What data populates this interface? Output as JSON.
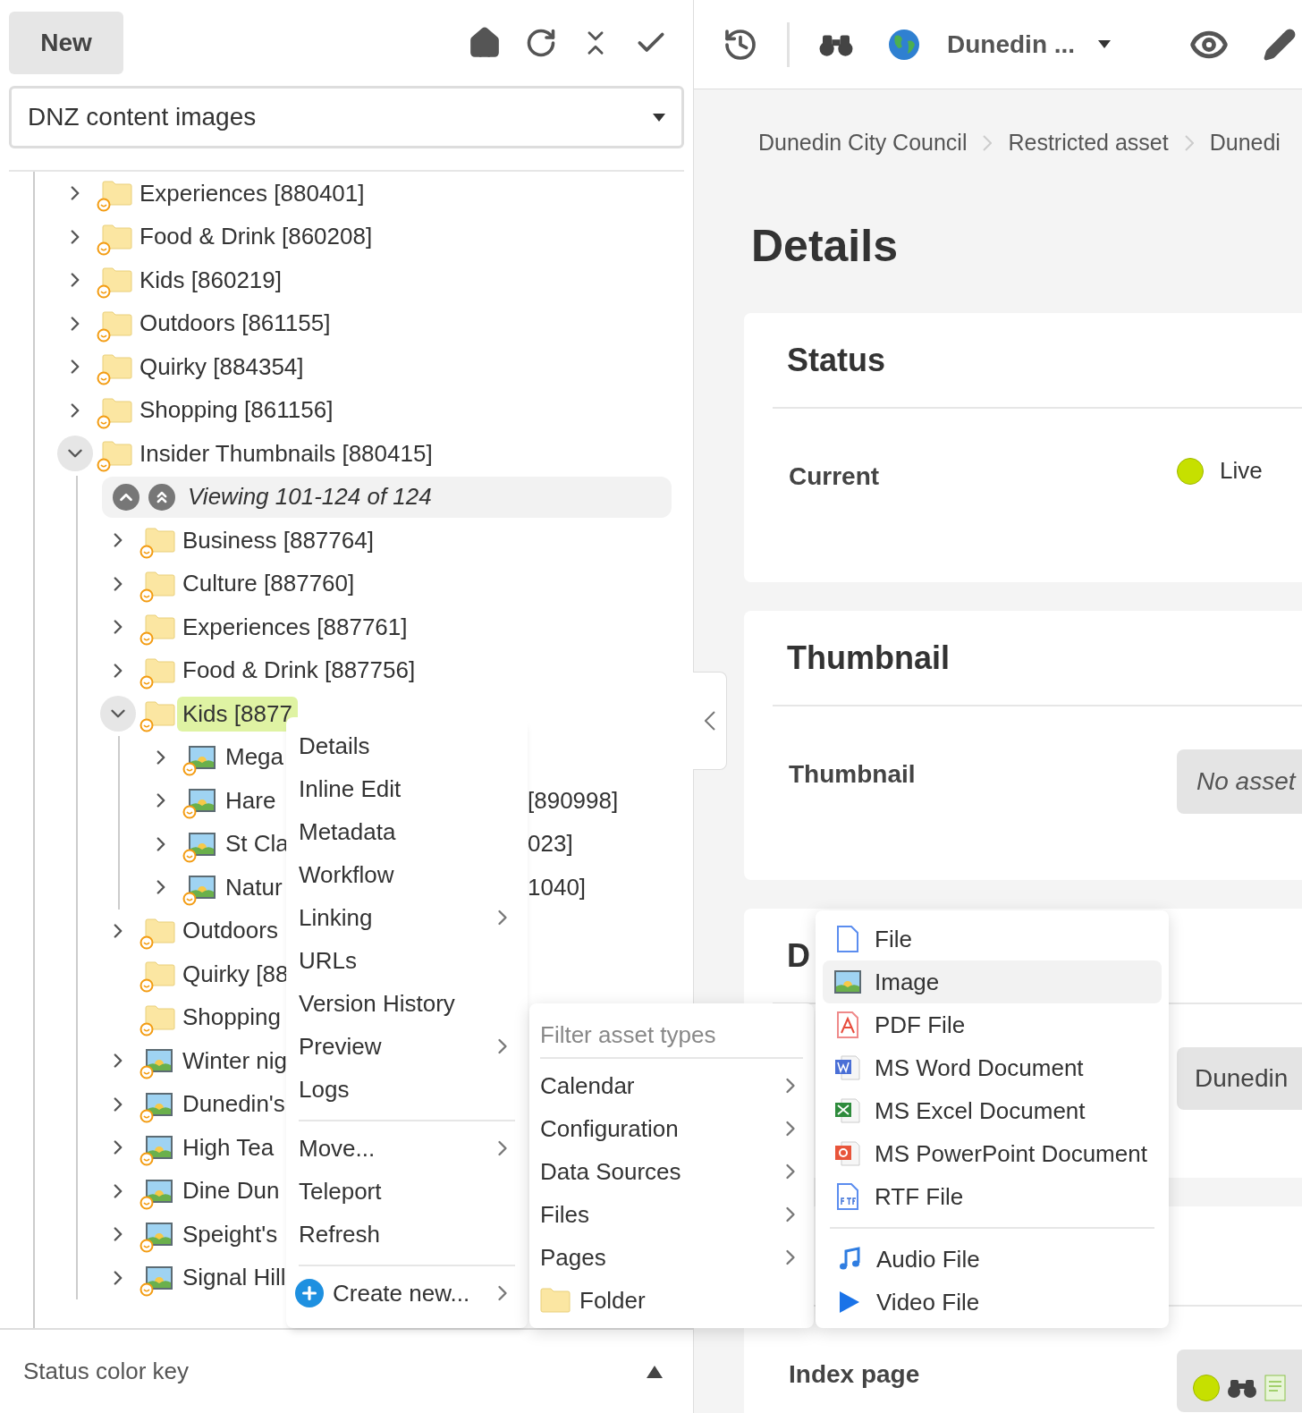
{
  "left_toolbar": {
    "new_button": "New"
  },
  "asset_selector": {
    "value": "DNZ content images"
  },
  "tree": [
    {
      "label": "Experiences [880401]",
      "kind": "folder",
      "expandable": true,
      "expanded": false,
      "selected": false
    },
    {
      "label": "Food & Drink [860208]",
      "kind": "folder",
      "expandable": true,
      "expanded": false,
      "selected": false
    },
    {
      "label": "Kids [860219]",
      "kind": "folder",
      "expandable": true,
      "expanded": false,
      "selected": false
    },
    {
      "label": "Outdoors [861155]",
      "kind": "folder",
      "expandable": true,
      "expanded": false,
      "selected": false
    },
    {
      "label": "Quirky [884354]",
      "kind": "folder",
      "expandable": true,
      "expanded": false,
      "selected": false
    },
    {
      "label": "Shopping [861156]",
      "kind": "folder",
      "expandable": true,
      "expanded": false,
      "selected": false
    },
    {
      "label": "Insider Thumbnails [880415]",
      "kind": "folder",
      "expandable": true,
      "expanded": true,
      "selected": false,
      "children": [
        {
          "label": "Viewing 101-124 of 124",
          "kind": "pager"
        },
        {
          "label": "Business [887764]",
          "kind": "folder",
          "expandable": true,
          "expanded": false,
          "selected": false
        },
        {
          "label": "Culture [887760]",
          "kind": "folder",
          "expandable": true,
          "expanded": false,
          "selected": false
        },
        {
          "label": "Experiences [887761]",
          "kind": "folder",
          "expandable": true,
          "expanded": false,
          "selected": false
        },
        {
          "label": "Food & Drink [887756]",
          "kind": "folder",
          "expandable": true,
          "expanded": false,
          "selected": false
        },
        {
          "label": "Kids [8877",
          "kind": "folder",
          "expandable": true,
          "expanded": true,
          "selected": true,
          "children": [
            {
              "label": "Mega",
              "kind": "image",
              "expandable": true,
              "expanded": false,
              "selected": false
            },
            {
              "label": "Hare",
              "tail": "[890998]",
              "kind": "image",
              "expandable": true,
              "expanded": false,
              "selected": false
            },
            {
              "label": "St Cla",
              "tail": "023]",
              "kind": "image",
              "expandable": true,
              "expanded": false,
              "selected": false
            },
            {
              "label": "Natur",
              "tail": "1040]",
              "kind": "image",
              "expandable": true,
              "expanded": false,
              "selected": false
            }
          ]
        },
        {
          "label": "Outdoors",
          "kind": "folder",
          "expandable": true,
          "expanded": false,
          "selected": false
        },
        {
          "label": "Quirky [88",
          "kind": "folder",
          "expandable": false,
          "expanded": false,
          "selected": false
        },
        {
          "label": "Shopping",
          "kind": "folder",
          "expandable": false,
          "expanded": false,
          "selected": false
        },
        {
          "label": "Winter nig",
          "kind": "image",
          "expandable": true,
          "expanded": false,
          "selected": false
        },
        {
          "label": "Dunedin's",
          "kind": "image",
          "expandable": true,
          "expanded": false,
          "selected": false
        },
        {
          "label": "High Tea",
          "kind": "image",
          "expandable": true,
          "expanded": false,
          "selected": false
        },
        {
          "label": "Dine Dun",
          "kind": "image",
          "expandable": true,
          "expanded": false,
          "selected": false
        },
        {
          "label": "Speight's",
          "kind": "image",
          "expandable": true,
          "expanded": false,
          "selected": false
        },
        {
          "label": "Signal Hill",
          "kind": "image",
          "expandable": true,
          "expanded": false,
          "selected": false
        }
      ]
    }
  ],
  "status_bar": {
    "label": "Status color key"
  },
  "top_bar": {
    "site": "Dunedin ..."
  },
  "breadcrumb": [
    "Dunedin City Council",
    "Restricted asset",
    "Dunedi"
  ],
  "page_title": "Details",
  "sections": [
    {
      "title": "Status",
      "fields": [
        {
          "label": "Current",
          "kind": "status",
          "value": "Live",
          "color": "#c6e000"
        }
      ]
    },
    {
      "title": "Thumbnail",
      "fields": [
        {
          "label": "Thumbnail",
          "kind": "empty",
          "value": "No asset"
        }
      ]
    },
    {
      "title": "D",
      "fields": [
        {
          "kind": "asset",
          "value": "Dunedin"
        }
      ]
    },
    {
      "fields": [
        {
          "label": "Index page",
          "kind": "links",
          "color": "#c6e000"
        }
      ]
    }
  ],
  "context_menu": {
    "groups": [
      [
        {
          "label": "Details",
          "submenu": false
        },
        {
          "label": "Inline Edit",
          "submenu": false
        },
        {
          "label": "Metadata",
          "submenu": false
        },
        {
          "label": "Workflow",
          "submenu": false
        },
        {
          "label": "Linking",
          "submenu": true
        },
        {
          "label": "URLs",
          "submenu": false
        },
        {
          "label": "Version History",
          "submenu": false
        },
        {
          "label": "Preview",
          "submenu": true
        },
        {
          "label": "Logs",
          "submenu": false
        }
      ],
      [
        {
          "label": "Move...",
          "submenu": true
        },
        {
          "label": "Teleport",
          "submenu": false
        },
        {
          "label": "Refresh",
          "submenu": false
        }
      ],
      [
        {
          "label": "Create new...",
          "submenu": true,
          "kind": "create"
        }
      ]
    ]
  },
  "asset_type_menu": {
    "placeholder": "Filter asset types",
    "items": [
      {
        "label": "Calendar",
        "kind": "category"
      },
      {
        "label": "Configuration",
        "kind": "category"
      },
      {
        "label": "Data Sources",
        "kind": "category"
      },
      {
        "label": "Files",
        "kind": "category"
      },
      {
        "label": "Pages",
        "kind": "category"
      },
      {
        "label": "Folder",
        "kind": "folder"
      }
    ]
  },
  "file_type_menu": {
    "groups": [
      [
        {
          "label": "File",
          "kind": "file",
          "selected": false
        },
        {
          "label": "Image",
          "kind": "image",
          "selected": true
        },
        {
          "label": "PDF File",
          "kind": "pdf",
          "selected": false
        },
        {
          "label": "MS Word Document",
          "kind": "word",
          "selected": false
        },
        {
          "label": "MS Excel Document",
          "kind": "excel",
          "selected": false
        },
        {
          "label": "MS PowerPoint Document",
          "kind": "powerpoint",
          "selected": false
        },
        {
          "label": "RTF File",
          "kind": "rtf",
          "selected": false
        }
      ],
      [
        {
          "label": "Audio File",
          "kind": "audio",
          "selected": false
        },
        {
          "label": "Video File",
          "kind": "video",
          "selected": false
        }
      ]
    ]
  }
}
